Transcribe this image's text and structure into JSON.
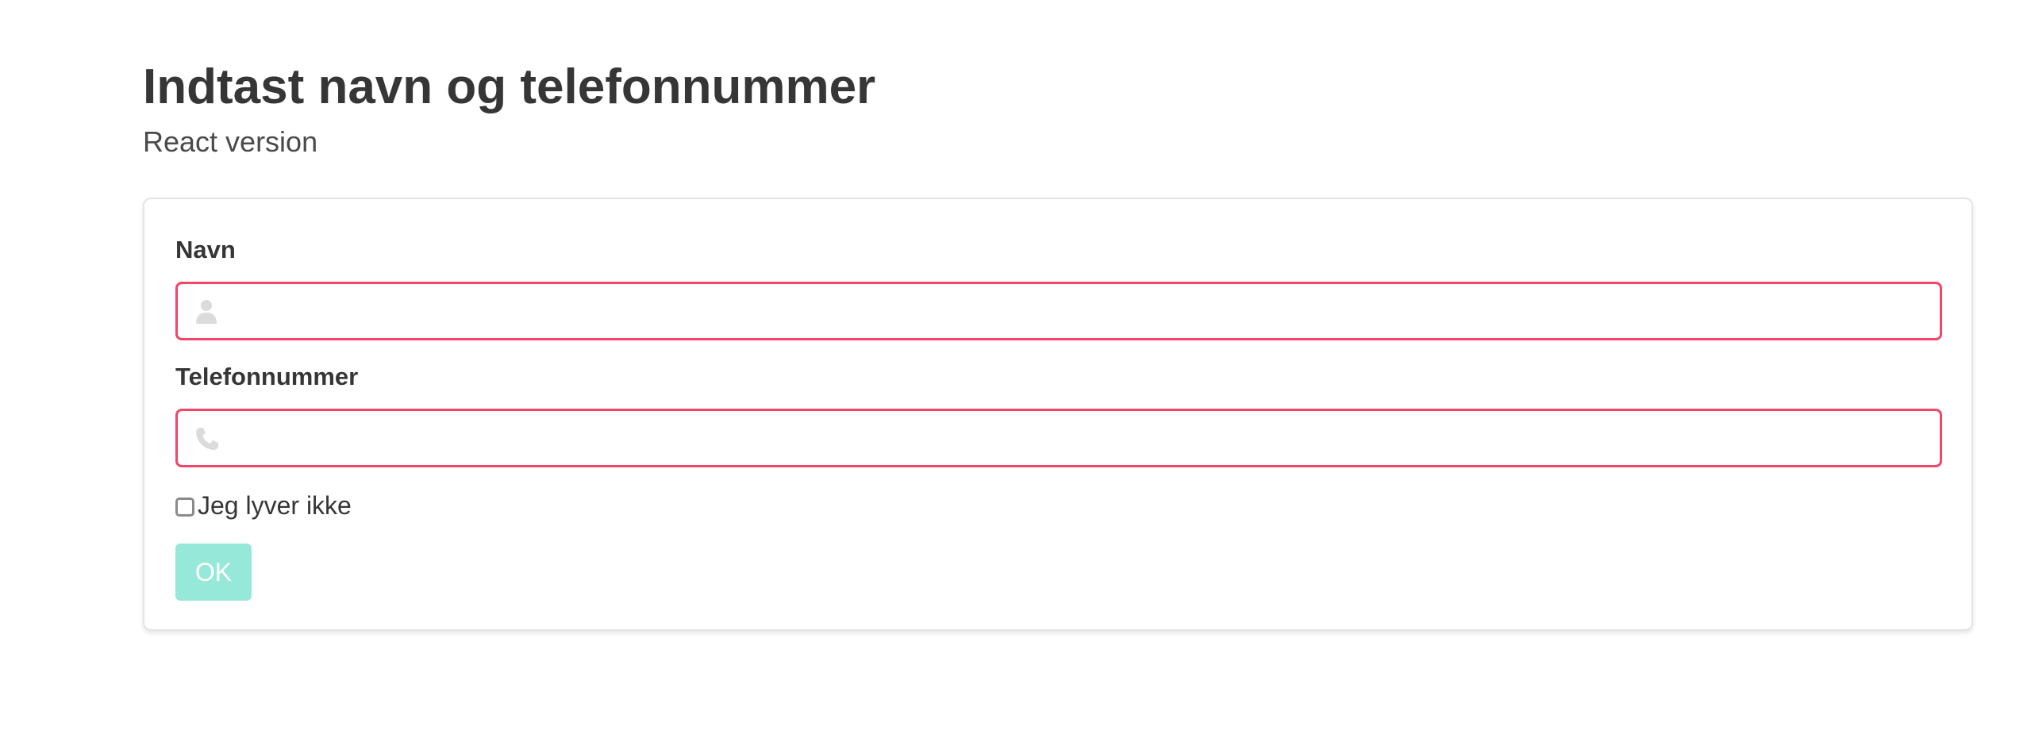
{
  "header": {
    "title": "Indtast navn og telefonnummer",
    "subtitle": "React version"
  },
  "form": {
    "name_label": "Navn",
    "name_value": "",
    "name_icon": "user-icon",
    "phone_label": "Telefonnummer",
    "phone_value": "",
    "phone_icon": "phone-icon",
    "checkbox_label": "Jeg lyver ikke",
    "checkbox_checked": false,
    "ok_label": "OK",
    "ok_disabled": true
  },
  "colors": {
    "error_border": "#f14668",
    "button_disabled": "#96e9d9",
    "text": "#363636",
    "icon": "#dbdbdb"
  }
}
